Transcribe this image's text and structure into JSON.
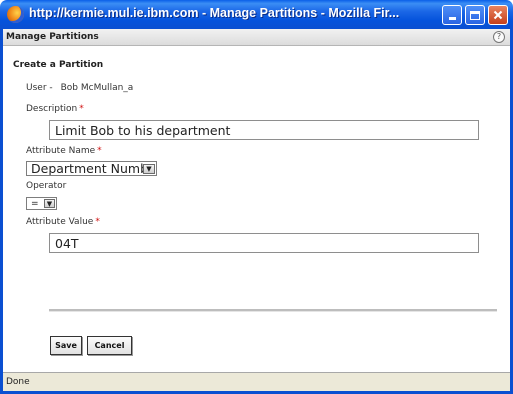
{
  "window": {
    "title": "http://kermie.mul.ie.ibm.com - Manage Partitions - Mozilla Fir..."
  },
  "dialog": {
    "title": "Manage Partitions",
    "help_glyph": "?"
  },
  "form": {
    "section_title": "Create a Partition",
    "user_label": "User -",
    "user_value": "Bob McMullan_a",
    "required_marker": "*",
    "description_label": "Description",
    "description_value": "Limit Bob to his department",
    "attribute_name_label": "Attribute Name",
    "attribute_name_value": "Department Numbe",
    "operator_label": "Operator",
    "operator_value": "=",
    "attribute_value_label": "Attribute Value",
    "attribute_value_value": "04T"
  },
  "buttons": {
    "save": "Save",
    "cancel": "Cancel"
  },
  "status": {
    "text": "Done"
  },
  "colors": {
    "titlebar": "#0a4fd1",
    "required": "#d01010",
    "close_button": "#c5401c"
  }
}
